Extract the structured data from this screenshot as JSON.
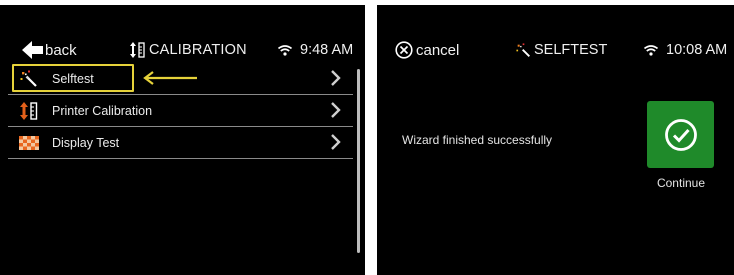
{
  "colors": {
    "screen_bg": "#000000",
    "highlight": "#e6d23a",
    "continue_bg": "#1f8a2a",
    "calibration_icon": "#e2601a"
  },
  "left_screen": {
    "back_label": "back",
    "title": "CALIBRATION",
    "time": "9:48 AM",
    "menu": [
      {
        "label": "Selftest",
        "icon": "magic-wand-icon"
      },
      {
        "label": "Printer Calibration",
        "icon": "calibration-icon"
      },
      {
        "label": "Display Test",
        "icon": "checkerboard-icon"
      }
    ]
  },
  "right_screen": {
    "cancel_label": "cancel",
    "title": "SELFTEST",
    "time": "10:08 AM",
    "message": "Wizard finished successfully",
    "continue_label": "Continue"
  }
}
